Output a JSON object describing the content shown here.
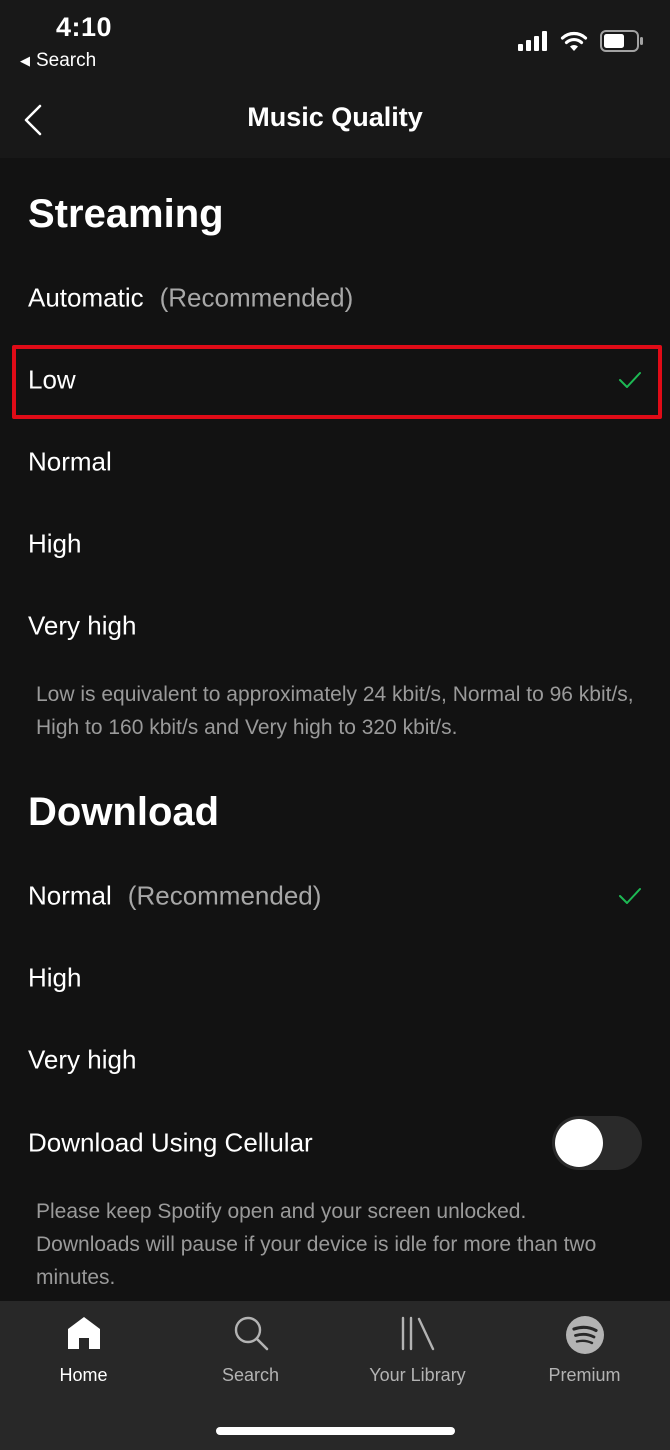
{
  "status": {
    "time": "4:10",
    "back_label": "Search"
  },
  "nav": {
    "title": "Music Quality"
  },
  "streaming": {
    "title": "Streaming",
    "options": [
      {
        "label": "Automatic",
        "suffix": "(Recommended)",
        "selected": false
      },
      {
        "label": "Low",
        "suffix": "",
        "selected": true
      },
      {
        "label": "Normal",
        "suffix": "",
        "selected": false
      },
      {
        "label": "High",
        "suffix": "",
        "selected": false
      },
      {
        "label": "Very high",
        "suffix": "",
        "selected": false
      }
    ],
    "note": "Low is equivalent to approximately 24 kbit/s, Normal to 96 kbit/s, High to 160 kbit/s and Very high to 320 kbit/s."
  },
  "download": {
    "title": "Download",
    "options": [
      {
        "label": "Normal",
        "suffix": "(Recommended)",
        "selected": true
      },
      {
        "label": "High",
        "suffix": "",
        "selected": false
      },
      {
        "label": "Very high",
        "suffix": "",
        "selected": false
      }
    ],
    "cellular_label": "Download Using Cellular",
    "cellular_enabled": false,
    "note": "Please keep Spotify open and your screen unlocked. Downloads will pause if your device is idle for more than two minutes."
  },
  "tabs": [
    {
      "label": "Home",
      "icon": "home-icon",
      "active": true
    },
    {
      "label": "Search",
      "icon": "search-icon",
      "active": false
    },
    {
      "label": "Your Library",
      "icon": "library-icon",
      "active": false
    },
    {
      "label": "Premium",
      "icon": "spotify-logo-icon",
      "active": false
    }
  ],
  "colors": {
    "background": "#121212",
    "check": "#1db954",
    "highlight": "#e00b17"
  }
}
